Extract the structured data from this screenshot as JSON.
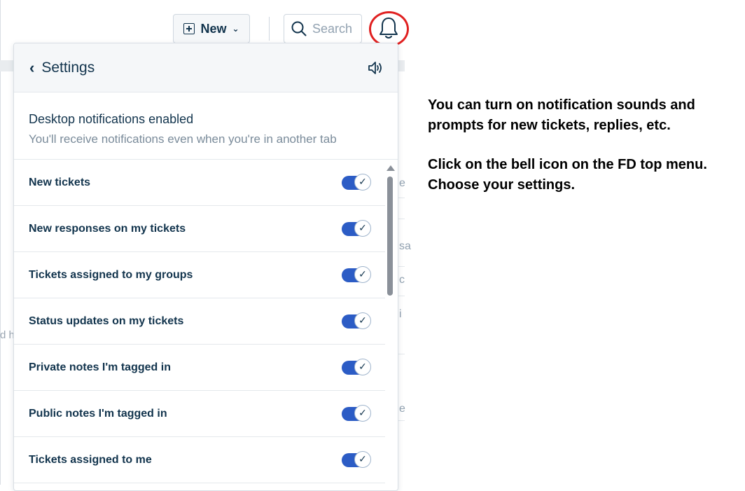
{
  "topbar": {
    "new_label": "New",
    "search_placeholder": "Search"
  },
  "background": {
    "peeks": [
      "e",
      "sa",
      "c",
      "i",
      "e"
    ],
    "left_edge_text": "d h"
  },
  "panel": {
    "title": "Settings",
    "desktop_title": "Desktop notifications enabled",
    "desktop_sub": "You'll receive notifications even when you're in another tab",
    "items": [
      {
        "label": "New tickets",
        "enabled": true
      },
      {
        "label": "New responses on my tickets",
        "enabled": true
      },
      {
        "label": "Tickets assigned to my groups",
        "enabled": true
      },
      {
        "label": "Status updates on my tickets",
        "enabled": true
      },
      {
        "label": "Private notes I'm tagged in",
        "enabled": true
      },
      {
        "label": "Public notes I'm tagged in",
        "enabled": true
      },
      {
        "label": "Tickets assigned to me",
        "enabled": true
      }
    ]
  },
  "instructions": {
    "p1": "You can turn on notification sounds and prompts for new tickets, replies, etc.",
    "p2": "Click on the bell icon on the FD top menu. Choose your settings."
  },
  "colors": {
    "toggle_on": "#2c5cc5",
    "highlight_ring": "#e02020",
    "text_primary": "#12344d"
  }
}
